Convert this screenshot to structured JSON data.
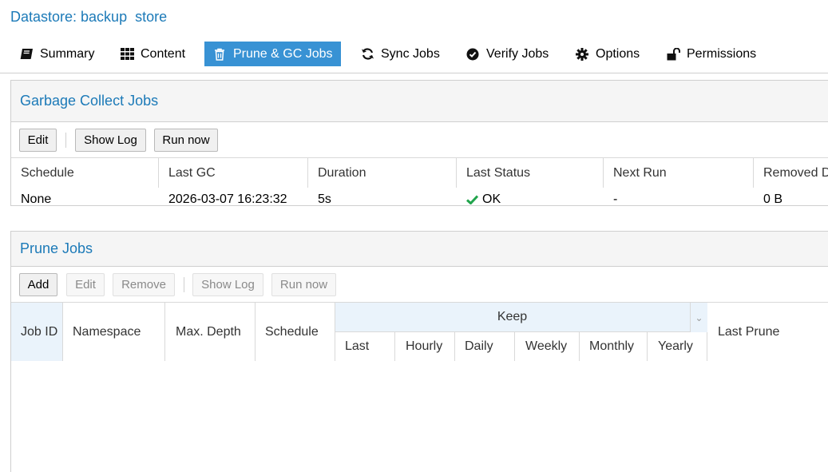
{
  "header": {
    "title": "Datastore: backup  store"
  },
  "tabs": [
    {
      "label": "Summary",
      "icon": "book-icon",
      "active": false
    },
    {
      "label": "Content",
      "icon": "grid-icon",
      "active": false
    },
    {
      "label": "Prune & GC Jobs",
      "icon": "trash-icon",
      "active": true
    },
    {
      "label": "Sync Jobs",
      "icon": "refresh-icon",
      "active": false
    },
    {
      "label": "Verify Jobs",
      "icon": "check-circle-icon",
      "active": false
    },
    {
      "label": "Options",
      "icon": "gear-icon",
      "active": false
    },
    {
      "label": "Permissions",
      "icon": "unlock-icon",
      "active": false
    }
  ],
  "gc": {
    "title": "Garbage Collect Jobs",
    "toolbar": {
      "edit": "Edit",
      "show_log": "Show Log",
      "run_now": "Run now"
    },
    "columns": [
      "Schedule",
      "Last GC",
      "Duration",
      "Last Status",
      "Next Run",
      "Removed D"
    ],
    "row": {
      "schedule": "None",
      "last_gc": "2026-03-07 16:23:32",
      "duration": "5s",
      "last_status": "OK",
      "next_run": "-",
      "removed": "0 B"
    }
  },
  "prune": {
    "title": "Prune Jobs",
    "toolbar": {
      "add": "Add",
      "edit": "Edit",
      "remove": "Remove",
      "show_log": "Show Log",
      "run_now": "Run now"
    },
    "columns": {
      "job_id": "Job ID",
      "namespace": "Namespace",
      "max_depth": "Max. Depth",
      "schedule": "Schedule",
      "keep": "Keep",
      "keep_sub": [
        "Last",
        "Hourly",
        "Daily",
        "Weekly",
        "Monthly",
        "Yearly"
      ],
      "last_prune": "Last Prune"
    }
  },
  "colors": {
    "accent": "#3892d4",
    "title_blue": "#1c7ab8",
    "ok_green": "#21a44c"
  }
}
